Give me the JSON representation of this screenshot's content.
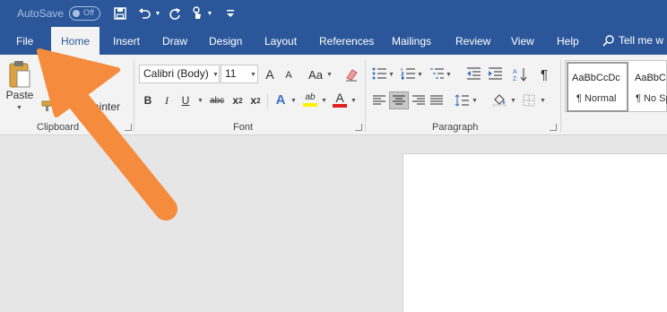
{
  "titlebar": {
    "autosave_label": "AutoSave",
    "autosave_state": "Off",
    "qat_icons": [
      "save-icon",
      "undo-icon",
      "redo-icon",
      "touch-mode-icon",
      "customize-qat-icon"
    ]
  },
  "tabs": {
    "file": "File",
    "home": "Home",
    "insert": "Insert",
    "draw": "Draw",
    "design": "Design",
    "layout": "Layout",
    "references": "References",
    "mailings": "Mailings",
    "review": "Review",
    "view": "View",
    "help": "Help",
    "tellme": "Tell me w"
  },
  "clipboard": {
    "paste": "Paste",
    "format_painter": "ainter",
    "group_label": "Clipboard"
  },
  "font": {
    "font_name": "Calibri (Body)",
    "font_size": "11",
    "grow": "A",
    "shrink": "A",
    "change_case": "Aa",
    "bold": "B",
    "italic": "I",
    "underline": "U",
    "strikethrough": "abc",
    "subscript": "x",
    "superscript": "x",
    "subscript_mark": "2",
    "superscript_mark": "2",
    "text_effects": "A",
    "highlight": "ab",
    "font_color": "A",
    "group_label": "Font"
  },
  "paragraph": {
    "group_label": "Paragraph",
    "pilcrow": "¶"
  },
  "styles": {
    "normal_sample": "AaBbCcDc",
    "normal_name": "¶ Normal",
    "nospacing_sample": "AaBbC",
    "nospacing_name": "¶ No Sp"
  },
  "colors": {
    "brand_blue": "#2b579a",
    "arrow_orange": "#f58b3c",
    "highlight_yellow": "#fff200",
    "font_red": "#e02020"
  }
}
